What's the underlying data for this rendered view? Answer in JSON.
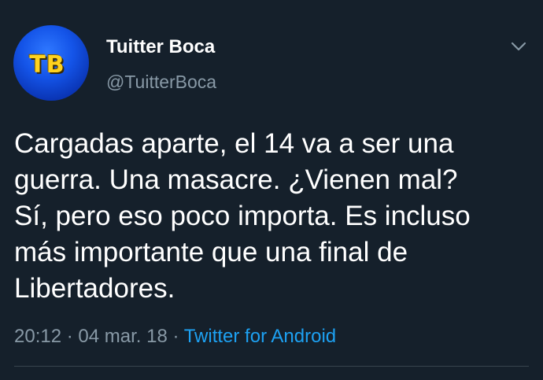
{
  "author": {
    "avatar_initials": "TB",
    "display_name": "Tuitter Boca",
    "handle": "@TuitterBoca"
  },
  "tweet": {
    "text": "Cargadas aparte, el 14 va a ser una\nguerra. Una masacre. ¿Vienen mal?\nSí, pero eso poco importa. Es incluso\nmás importante que una final de\nLibertadores.",
    "time": "20:12",
    "date": "04 mar. 18",
    "separator": " · ",
    "source": "Twitter for Android"
  },
  "icons": {
    "menu": "chevron-down-icon"
  },
  "colors": {
    "background": "#15202b",
    "primary_text": "#ffffff",
    "secondary_text": "#8899a6",
    "link": "#1da1f2",
    "divider": "#38444d",
    "avatar_bg": "#1454e8",
    "avatar_text": "#ffd21f"
  }
}
